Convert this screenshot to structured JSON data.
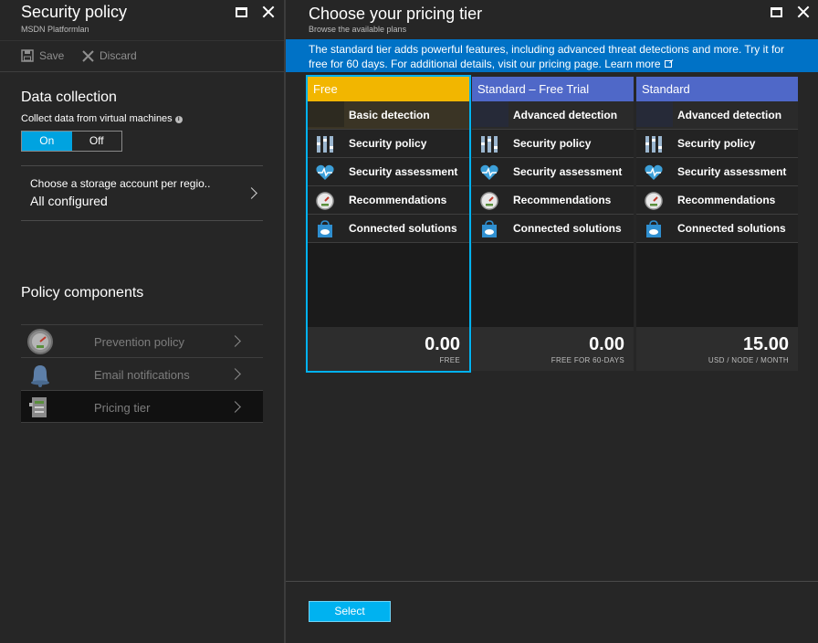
{
  "left_blade": {
    "title": "Security policy",
    "subtitle": "MSDN Platformlan",
    "toolbar": {
      "save_label": "Save",
      "discard_label": "Discard"
    },
    "data_collection": {
      "heading": "Data collection",
      "collect_label": "Collect data from virtual machines",
      "toggle": {
        "on_label": "On",
        "off_label": "Off",
        "selected": "On"
      }
    },
    "storage": {
      "label": "Choose a storage account per regio..",
      "value": "All configured"
    },
    "policy_components": {
      "heading": "Policy components",
      "items": [
        {
          "label": "Prevention policy",
          "icon": "gauge-icon"
        },
        {
          "label": "Email notifications",
          "icon": "bell-icon"
        },
        {
          "label": "Pricing tier",
          "icon": "pricing-icon",
          "selected": true
        }
      ]
    }
  },
  "right_blade": {
    "title": "Choose your pricing tier",
    "subtitle": "Browse the available plans",
    "banner": {
      "text": "The standard tier adds powerful features, including advanced threat detections and more. Try it for free for 60 days. For additional details, visit our pricing page.",
      "link": "Learn more"
    },
    "tiers": [
      {
        "name": "Free",
        "header_color": "#f2b600",
        "detection": "Basic detection",
        "features": [
          "Security policy",
          "Security assessment",
          "Recommendations",
          "Connected solutions"
        ],
        "price": "0.00",
        "price_note": "FREE",
        "selected": true
      },
      {
        "name": "Standard – Free Trial",
        "header_color": "#4f68c8",
        "detection": "Advanced detection",
        "features": [
          "Security policy",
          "Security assessment",
          "Recommendations",
          "Connected solutions"
        ],
        "price": "0.00",
        "price_note": "FREE FOR 60-DAYS",
        "selected": false
      },
      {
        "name": "Standard",
        "header_color": "#4f68c8",
        "detection": "Advanced detection",
        "features": [
          "Security policy",
          "Security assessment",
          "Recommendations",
          "Connected solutions"
        ],
        "price": "15.00",
        "price_note": "USD / NODE / MONTH",
        "selected": false
      }
    ],
    "select_label": "Select"
  },
  "colors": {
    "accent": "#00b2f0",
    "toggle_on": "#00a3e0",
    "banner": "#0072c6",
    "free_header": "#f2b600",
    "standard_header": "#4f68c8"
  }
}
